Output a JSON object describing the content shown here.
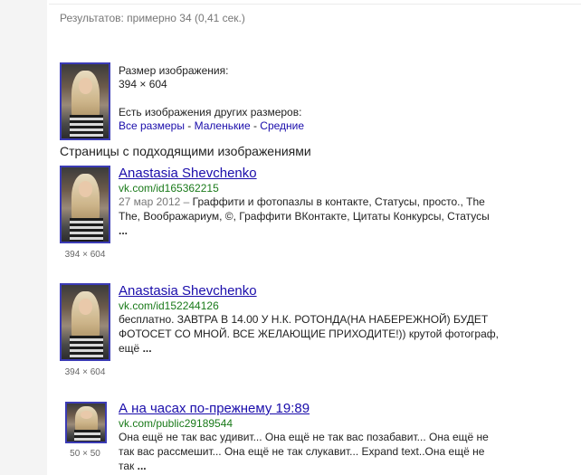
{
  "results_stats": "Результатов: примерно 34 (0,41 сек.)",
  "image_info": {
    "size_heading": "Размер изображения:",
    "size_value": "394 × 604",
    "other_sizes_text": "Есть изображения других размеров:",
    "size_links": [
      "Все размеры",
      "Маленькие",
      "Средние"
    ],
    "separator": " - "
  },
  "section_heading": "Страницы с подходящими изображениями",
  "results": [
    {
      "title": "Anastasia Shevchenko",
      "url": "vk.com/id165362215",
      "date": "27 мар 2012 – ",
      "snippet": "Граффити и фотопазлы в контакте, Статусы, просто., The The, Воображариум, ©, Граффити ВКонтакте, Цитаты Конкурсы, Статусы",
      "ellipsis": "...",
      "thumb_size": "394 × 604"
    },
    {
      "title": "Anastasia Shevchenko",
      "url": "vk.com/id152244126",
      "date": "",
      "snippet": "бесплатно. ЗАВТРА В 14.00 У Н.К. РОТОНДА(НА НАБЕРЕЖНОЙ) БУДЕТ ФОТОСЕТ СО МНОЙ. ВСЕ ЖЕЛАЮЩИЕ ПРИХОДИТЕ!)) крутой фотограф, ещё ",
      "ellipsis": "...",
      "thumb_size": "394 × 604"
    },
    {
      "title": "А на часах по-прежнему 19:89",
      "url": "vk.com/public29189544",
      "date": "",
      "snippet": "Она ещё не так вас удивит... Она ещё не так вас позабавит... Она ещё не так вас рассмешит... Она ещё не так слукавит... Expand text..Она ещё не так ",
      "ellipsis": "...",
      "thumb_size": "50 × 50"
    }
  ]
}
